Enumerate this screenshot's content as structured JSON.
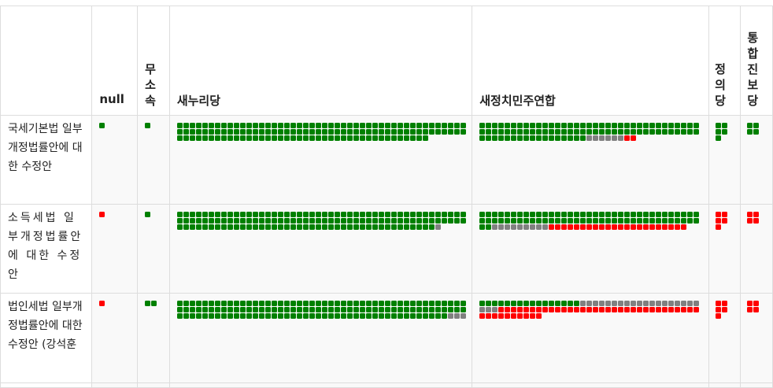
{
  "columns": {
    "bill": "",
    "null": "null",
    "independent": [
      "무",
      "소",
      "속"
    ],
    "saenuri": "새누리당",
    "npad": "새정치민주연합",
    "justice": [
      "정",
      "의",
      "당"
    ],
    "unified": [
      "통",
      "합",
      "진",
      "보",
      "당"
    ]
  },
  "colors": {
    "yes": "#008000",
    "abstain": "#808080",
    "no": "#ff0000"
  },
  "rows": [
    {
      "bill": "국세기본법 일부개정법률안에 대한 수정안",
      "votes": {
        "null": {
          "perRow": 1,
          "yes": 0,
          "abstain": 0,
          "no": 0,
          "order": [
            "yes"
          ],
          "extra_yes": 1
        },
        "independent": {
          "perRow": 2,
          "yes": 1,
          "abstain": 0,
          "no": 0
        },
        "saenuri": {
          "perRow": 46,
          "yes": 132,
          "abstain": 0,
          "no": 0
        },
        "npad": {
          "perRow": 35,
          "yes": 87,
          "abstain": 6,
          "no": 2
        },
        "justice": {
          "perRow": 2,
          "yes": 5,
          "abstain": 0,
          "no": 0
        },
        "unified": {
          "perRow": 2,
          "yes": 4,
          "abstain": 0,
          "no": 0
        }
      }
    },
    {
      "bill": "소득세법 일부개정법률안에 대한 수정안",
      "votes": {
        "null": {
          "perRow": 1,
          "yes": 0,
          "abstain": 0,
          "no": 1
        },
        "independent": {
          "perRow": 2,
          "yes": 1,
          "abstain": 0,
          "no": 0
        },
        "saenuri": {
          "perRow": 46,
          "yes": 133,
          "abstain": 1,
          "no": 0
        },
        "npad": {
          "perRow": 35,
          "yes": 72,
          "abstain": 9,
          "no": 22
        },
        "justice": {
          "perRow": 2,
          "yes": 0,
          "abstain": 0,
          "no": 5
        },
        "unified": {
          "perRow": 2,
          "yes": 0,
          "abstain": 0,
          "no": 4
        }
      }
    },
    {
      "bill": "법인세법 일부개정법률안에 대한 수정안 (강석훈",
      "votes": {
        "null": {
          "perRow": 1,
          "yes": 0,
          "abstain": 0,
          "no": 1
        },
        "independent": {
          "perRow": 2,
          "yes": 2,
          "abstain": 0,
          "no": 0
        },
        "saenuri": {
          "perRow": 46,
          "yes": 135,
          "abstain": 3,
          "no": 0
        },
        "npad": {
          "perRow": 35,
          "yes": 16,
          "abstain": 22,
          "no": 42
        },
        "justice": {
          "perRow": 2,
          "yes": 0,
          "abstain": 0,
          "no": 5
        },
        "unified": {
          "perRow": 2,
          "yes": 0,
          "abstain": 0,
          "no": 4
        }
      }
    }
  ]
}
